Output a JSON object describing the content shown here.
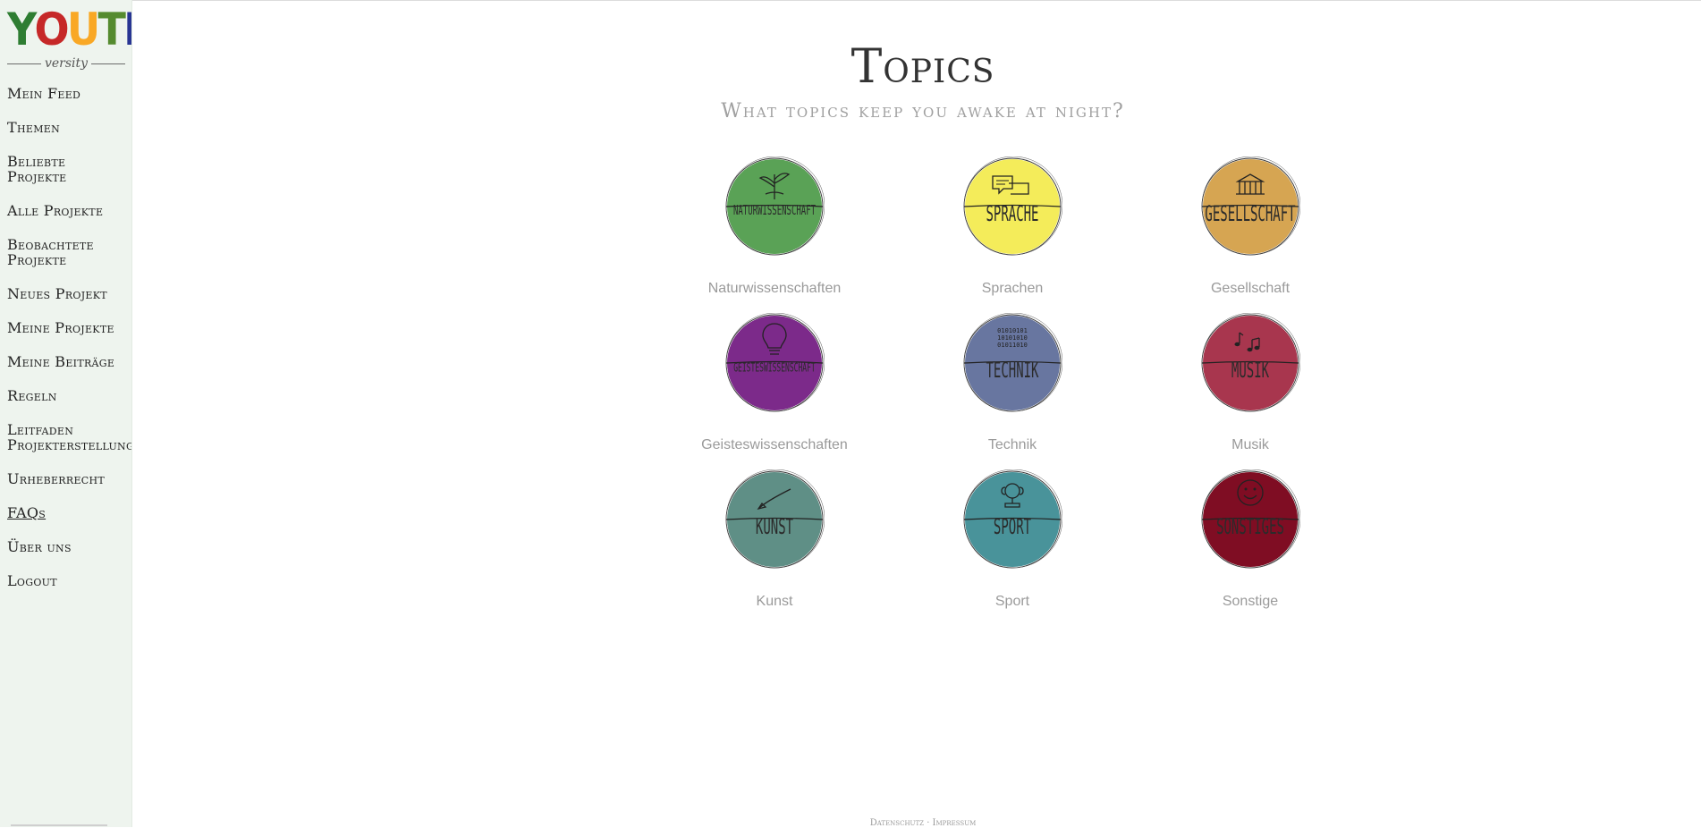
{
  "logo": {
    "letters": [
      "Y",
      "O",
      "U",
      "T",
      "H"
    ],
    "letter_colors": [
      "#2e7d32",
      "#c62828",
      "#f9a825",
      "#558b2f",
      "#283593"
    ],
    "sub": "versity"
  },
  "sidebar": {
    "items": [
      {
        "label": "Mein Feed"
      },
      {
        "label": "Themen"
      },
      {
        "label": "Beliebte Projekte"
      },
      {
        "label": "Alle Projekte"
      },
      {
        "label": "Beobachtete Projekte"
      },
      {
        "label": "Neues Projekt"
      },
      {
        "label": "Meine Projekte"
      },
      {
        "label": "Meine Beiträge"
      },
      {
        "label": "Regeln"
      },
      {
        "label": "Leitfaden Projekterstellung"
      },
      {
        "label": "Urheberrecht"
      },
      {
        "label": "FAQs"
      },
      {
        "label": "Über uns"
      },
      {
        "label": "Logout"
      }
    ]
  },
  "page": {
    "title": "Topics",
    "subtitle": "What topics keep you awake at night?"
  },
  "topics": [
    {
      "label": "Naturwissenschaften",
      "circle_text": "NATURWISSENSCHAFT",
      "color": "#5aa256",
      "icon": "plant-icon"
    },
    {
      "label": "Sprachen",
      "circle_text": "SPRACHE",
      "color": "#f4ec5a",
      "icon": "speech-bubble-icon"
    },
    {
      "label": "Gesellschaft",
      "circle_text": "GESELLSCHAFT",
      "color": "#d6a552",
      "icon": "building-icon"
    },
    {
      "label": "Geisteswissenschaften",
      "circle_text": "GEISTESWISSENSCHAFT",
      "color": "#7c2a8a",
      "icon": "lightbulb-icon"
    },
    {
      "label": "Technik",
      "circle_text": "TECHNIK",
      "color": "#6876a0",
      "icon": "binary-code-icon"
    },
    {
      "label": "Musik",
      "circle_text": "MUSIK",
      "color": "#a8364e",
      "icon": "music-notes-icon"
    },
    {
      "label": "Kunst",
      "circle_text": "KUNST",
      "color": "#5f8f86",
      "icon": "brush-icon"
    },
    {
      "label": "Sport",
      "circle_text": "SPORT",
      "color": "#49939a",
      "icon": "trophy-icon"
    },
    {
      "label": "Sonstige",
      "circle_text": "SONSTIGES",
      "color": "#7f0d23",
      "icon": "smiley-icon"
    }
  ],
  "footer": {
    "datenschutz": "Datenschutz",
    "impressum": "Impressum"
  }
}
